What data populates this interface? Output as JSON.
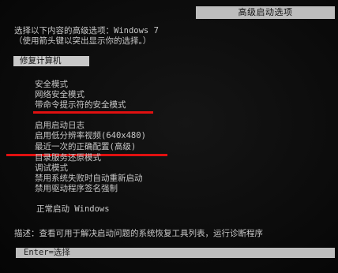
{
  "window": {
    "title": "高级启动选项"
  },
  "intro": {
    "line1": "选择以下内容的高级选项：Windows 7",
    "line2": "（使用箭头键以突出显示你的选择。）"
  },
  "repair": {
    "label": "修复计算机"
  },
  "options": {
    "safe_mode": "安全模式",
    "safe_mode_network": "网络安全模式",
    "safe_mode_cmd": "带命令提示符的安全模式",
    "boot_logging": "启用启动日志",
    "low_res_video": "启用低分辨率视频(640x480)",
    "last_known_good": "最近一次的正确配置(高级)",
    "ds_restore": "目录服务还原模式",
    "debug_mode": "调试模式",
    "disable_auto_restart": "禁用系统失败时自动重新启动",
    "disable_driver_sig": "禁用驱动程序签名强制",
    "normal_start": "正常启动 Windows"
  },
  "description": {
    "text": "描述：查看可用于解决启动问题的系统恢复工具列表，运行诊断程序"
  },
  "footer": {
    "hint": "Enter=选择"
  },
  "colors": {
    "background": "#0c0c0c",
    "text": "#c8c8c8",
    "highlight_bar": "#c8c8c8",
    "annotation_underline": "#e01010"
  }
}
